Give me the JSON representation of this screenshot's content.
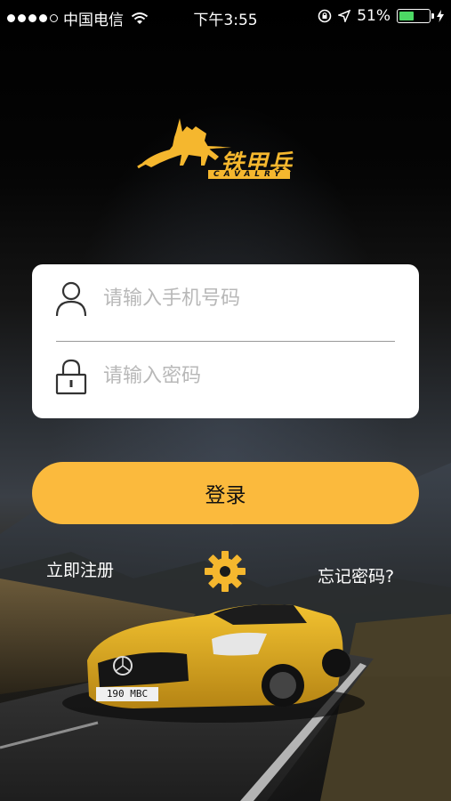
{
  "status_bar": {
    "carrier": "中国电信",
    "time": "下午3:55",
    "battery_percent": "51%",
    "battery_level": 0.51
  },
  "logo": {
    "text": "铁甲兵",
    "subtext": "CAVALRY"
  },
  "login_form": {
    "phone_placeholder": "请输入手机号码",
    "password_placeholder": "请输入密码",
    "login_label": "登录"
  },
  "links": {
    "register": "立即注册",
    "forgot": "忘记密码?"
  },
  "car_plate": "190 MBC",
  "colors": {
    "accent": "#fbba3d",
    "logo": "#f5b72e",
    "battery": "#4cd964"
  },
  "icons": {
    "phone_field": "user-icon",
    "password_field": "lock-icon",
    "settings": "gear-icon"
  }
}
